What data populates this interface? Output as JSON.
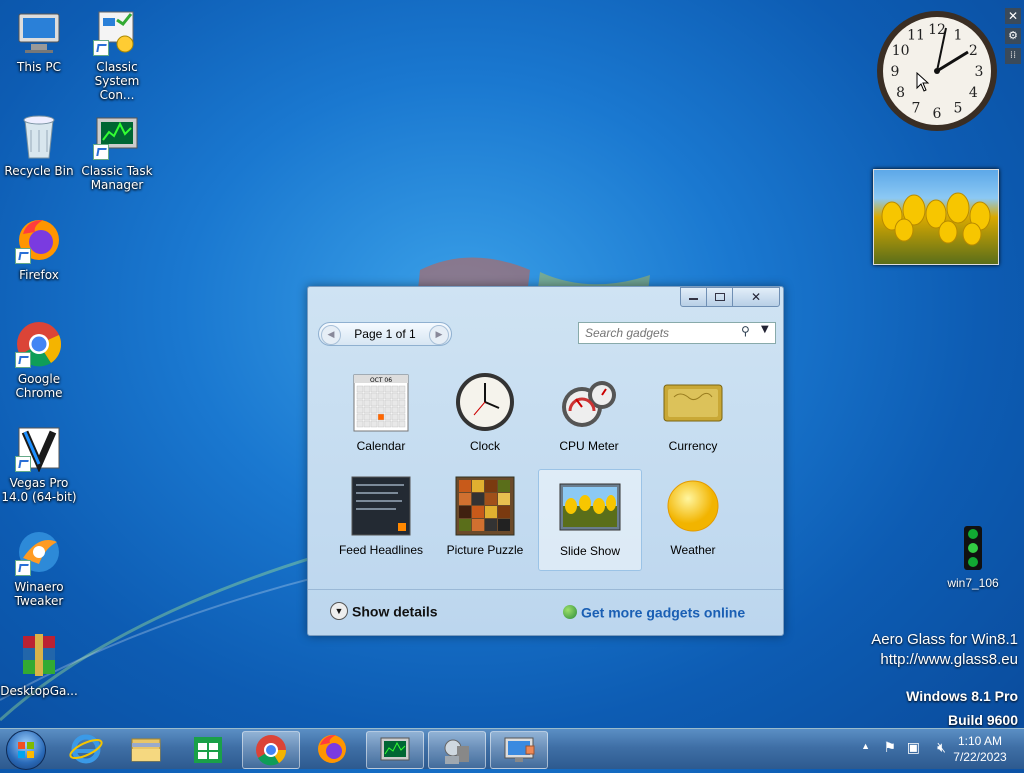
{
  "desktop_icons": [
    {
      "label": "This PC"
    },
    {
      "label": "Classic System Con..."
    },
    {
      "label": "Recycle Bin"
    },
    {
      "label": "Classic Task Manager"
    },
    {
      "label": "Firefox"
    },
    {
      "label": "Google Chrome"
    },
    {
      "label": "Vegas Pro 14.0 (64-bit)"
    },
    {
      "label": "Winaero Tweaker"
    },
    {
      "label": "DesktopGa..."
    }
  ],
  "traffic_light": {
    "label": "win7_106"
  },
  "clock_gadget": {
    "numbers": [
      "12",
      "1",
      "2",
      "3",
      "4",
      "5",
      "6",
      "7",
      "8",
      "9",
      "10",
      "11"
    ]
  },
  "gadget_window": {
    "page_text": "Page 1 of 1",
    "search_placeholder": "Search gadgets",
    "gadgets": [
      {
        "label": "Calendar"
      },
      {
        "label": "Clock"
      },
      {
        "label": "CPU Meter"
      },
      {
        "label": "Currency"
      },
      {
        "label": "Feed Headlines"
      },
      {
        "label": "Picture Puzzle"
      },
      {
        "label": "Slide Show"
      },
      {
        "label": "Weather"
      }
    ],
    "show_details": "Show details",
    "get_more": "Get more gadgets online",
    "calendar_month": "OCT 06"
  },
  "watermark": {
    "line1": "Aero Glass for Win8.1",
    "line2": "http://www.glass8.eu",
    "line3": "Windows 8.1 Pro",
    "line4": "Build 9600"
  },
  "tray": {
    "time": "1:10 AM",
    "date": "7/22/2023"
  }
}
